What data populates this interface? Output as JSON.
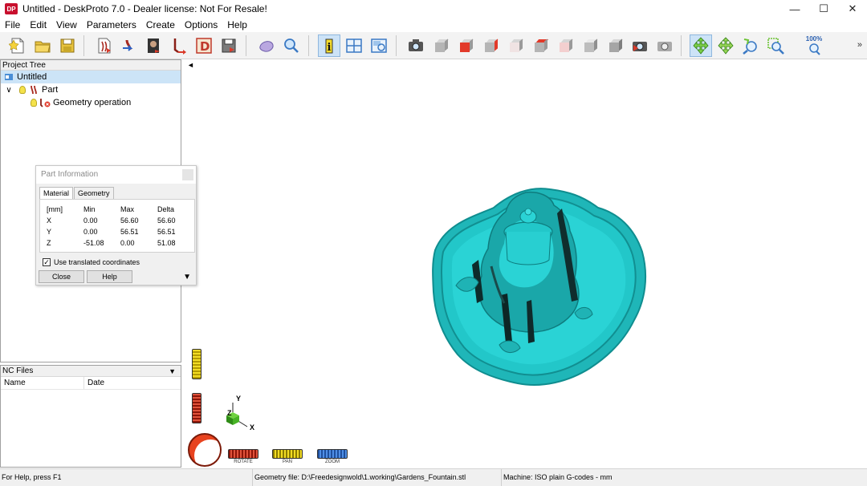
{
  "window": {
    "logo": "DP",
    "title": "Untitled - DeskProto 7.0 - Dealer license: Not For Resale!",
    "controls": {
      "minimize": "—",
      "maximize": "☐",
      "close": "✕"
    }
  },
  "menu": [
    "File",
    "Edit",
    "View",
    "Parameters",
    "Create",
    "Options",
    "Help"
  ],
  "toolbar": {
    "icons": [
      "new-file-icon",
      "open-folder-icon",
      "save-disk-icon",
      "import-geometry-icon",
      "part-move-icon",
      "part-image-icon",
      "toolpath-icon",
      "d-letter-icon",
      "export-disk-icon",
      "shape-icon",
      "magnifier-icon",
      "info-icon",
      "viewport-icon",
      "display-icon",
      "camera-icon",
      "view-front-icon",
      "view-right-icon",
      "view-back-icon",
      "view-left-icon",
      "view-top-icon",
      "view-bottom-icon",
      "view-iso1-icon",
      "view-iso2-icon",
      "view-reset-icon",
      "view-refresh-icon",
      "rotate-mode-icon",
      "pan-mode-icon",
      "zoom-in-icon",
      "zoom-window-icon",
      "zoom-100-icon"
    ],
    "zoom_100_label": "100%",
    "more": "»",
    "colors": {
      "cube_red": "#e23a2a",
      "cube_gray": "#8f8f8f",
      "cube_white": "#e9e9e9"
    }
  },
  "project_tree": {
    "header": "Project Tree",
    "items": [
      {
        "label": "Untitled",
        "level": 0
      },
      {
        "label": "Part",
        "level": 1,
        "expander": "∨"
      },
      {
        "label": "Geometry operation",
        "level": 2
      }
    ]
  },
  "nc_files": {
    "header": "NC Files",
    "dropdown": "▼",
    "columns": [
      "Name",
      "Date"
    ]
  },
  "part_info": {
    "title": "Part Information",
    "tabs": [
      "Material",
      "Geometry"
    ],
    "header": [
      "[mm]",
      "Min",
      "Max",
      "Delta"
    ],
    "rows": [
      [
        "X",
        "0.00",
        "56.60",
        "56.60"
      ],
      [
        "Y",
        "0.00",
        "56.51",
        "56.51"
      ],
      [
        "Z",
        "-51.08",
        "0.00",
        "51.08"
      ]
    ],
    "checkbox_label": "Use translated coordinates",
    "checkbox_mark": "✓",
    "close_label": "Close",
    "help_label": "Help",
    "expand_arrow": "▼"
  },
  "view": {
    "collapse_arrow": "◄",
    "model_color": "#22c7c9",
    "axes": {
      "x": "X",
      "y": "Y",
      "z": "Z"
    },
    "sliders": [
      "ROTATE",
      "PAN",
      "ZOOM"
    ]
  },
  "status": {
    "help": "For Help, press F1",
    "geometry": "Geometry file: D:\\Freedesignwold\\1.working\\Gardens_Fountain.stl",
    "machine": "Machine: ISO plain G-codes - mm"
  }
}
